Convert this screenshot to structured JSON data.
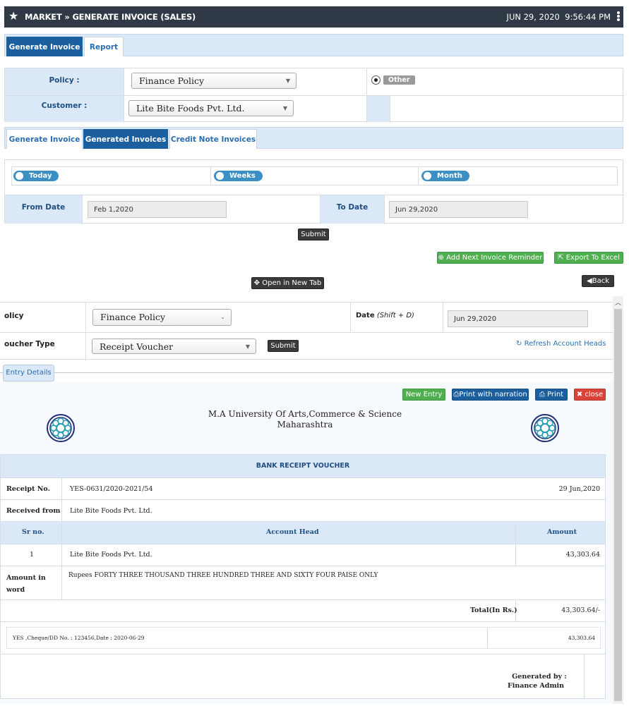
{
  "header": {
    "title": "MARKET » GENERATE INVOICE (SALES)",
    "date": "JUN 29, 2020",
    "time": "9:56:44 PM"
  },
  "top_tabs": [
    {
      "label": "Generate Invoice",
      "active": true
    },
    {
      "label": "Report",
      "active": false
    }
  ],
  "policy_form": {
    "policy_label": "Policy :",
    "policy_value": "Finance Policy",
    "other_label": "Other",
    "customer_label": "Customer :",
    "customer_value": "Lite Bite Foods Pvt. Ltd."
  },
  "sub_tabs": [
    {
      "label": "Generate Invoice",
      "active": false
    },
    {
      "label": "Generated Invoices",
      "active": true
    },
    {
      "label": "Credit Note Invoices",
      "active": false
    }
  ],
  "range": {
    "today": "Today",
    "weeks": "Weeks",
    "month": "Month",
    "from_label": "From Date",
    "from_value": "Feb 1,2020",
    "to_label": "To Date",
    "to_value": "Jun 29,2020",
    "submit": "Submit"
  },
  "actions": {
    "add_reminder": "Add Next Invoice Reminder",
    "export_excel": "Export To Excel",
    "open_new_tab": "Open in New Tab",
    "back": "Back"
  },
  "voucher_form": {
    "policy_label": "olicy",
    "policy_value": "Finance Policy",
    "date_label": "Date",
    "date_hint": "(Shift + D)",
    "date_value": "Jun 29,2020",
    "type_label": "oucher Type",
    "type_value": "Receipt Voucher",
    "submit": "Submit",
    "refresh": "Refresh Account Heads",
    "entry_tab": "Entry Details"
  },
  "voucher_buttons": {
    "new_entry": "New Entry",
    "print_narration": "Print with narration",
    "print": "Print",
    "close": "close"
  },
  "voucher": {
    "org_line1": "M.A University Of Arts,Commerce & Science",
    "org_line2": "Maharashtra",
    "heading": "BANK RECEIPT VOUCHER",
    "receipt_label": "Receipt No.",
    "receipt_value": "YES-0631/2020-2021/54",
    "receipt_date": "29 Jun,2020",
    "received_label": "Received from",
    "received_value": "Lite Bite Foods Pvt. Ltd.",
    "col_sr": "Sr no.",
    "col_head": "Account Head",
    "col_amount": "Amount",
    "row_sr": "1",
    "row_head": "Lite Bite Foods Pvt. Ltd.",
    "row_amount": "43,303.64",
    "words_label_1": "Amount in",
    "words_label_2": "word",
    "words_value": "Rupees FORTY THREE THOUSAND THREE HUNDRED THREE AND SIXTY FOUR PAISE ONLY",
    "total_label": "Total(In Rs.)",
    "total_value": "43,303.64/-",
    "cheque_text": "YES ,Cheque/DD No. : 123456,Date : 2020-06-29",
    "cheque_amount": "43,303.64",
    "generated_by": "Generated by :",
    "generated_name": "Finance Admin"
  },
  "colors": {
    "header_bg": "#2f3a46",
    "accent_blue": "#1c5f9e",
    "light_blue": "#dbe8f8",
    "green": "#4fae4f",
    "red": "#d9433a"
  }
}
